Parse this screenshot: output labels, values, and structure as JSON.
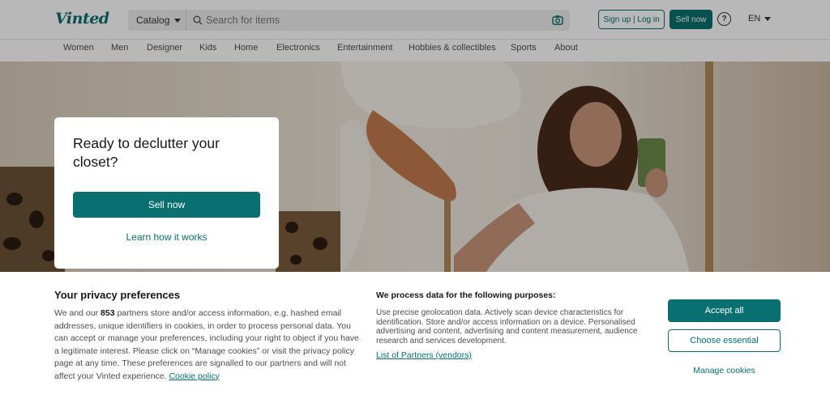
{
  "header": {
    "logo": "Vinted",
    "catalog_label": "Catalog",
    "search_placeholder": "Search for items",
    "signup_label": "Sign up | Log in",
    "sell_label": "Sell now",
    "help_symbol": "?",
    "language": "EN",
    "icons": [
      "search-icon",
      "camera-icon",
      "help-icon",
      "chevron-down-icon"
    ]
  },
  "nav": {
    "items": [
      "Women",
      "Men",
      "Designer",
      "Kids",
      "Home",
      "Electronics",
      "Entertainment",
      "Hobbies & collectibles",
      "Sports",
      "About"
    ]
  },
  "hero": {
    "title": "Ready to declutter your closet?",
    "sell_button": "Sell now",
    "learn_link": "Learn how it works"
  },
  "privacy": {
    "title": "Your privacy preferences",
    "text_before_count": "We and our ",
    "partner_count": "853",
    "text_after_count": " partners store and/or access information, e.g. hashed email addresses, unique identifiers in cookies, in order to process personal data. You can accept or manage your preferences, including your right to object if you have a legitimate interest. Please click on “Manage cookies” or visit the privacy policy page at any time. These preferences are signalled to our partners and will not affect your Vinted experience. ",
    "cookie_policy_link": "Cookie policy",
    "purposes_title": "We process data for the following purposes:",
    "purposes_text": "Use precise geolocation data. Actively scan device characteristics for identification. Store and/or access information on a device. Personalised advertising and content, advertising and content measurement, audience research and services development.",
    "partners_link": "List of Partners (vendors)",
    "accept_all": "Accept all",
    "choose_essential": "Choose essential",
    "manage_cookies": "Manage cookies"
  },
  "colors": {
    "brand": "#0a6f70"
  }
}
